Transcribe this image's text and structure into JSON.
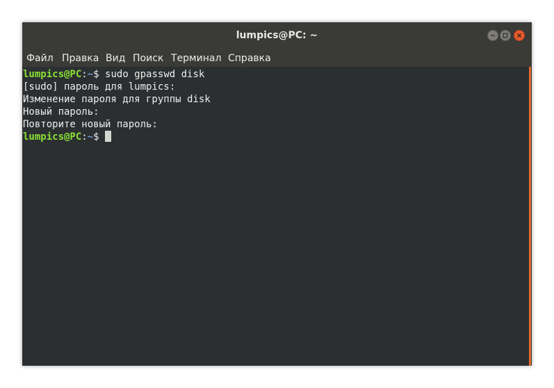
{
  "window": {
    "title": "lumpics@PC: ~"
  },
  "menu": {
    "items": [
      "Файл",
      "Правка",
      "Вид",
      "Поиск",
      "Терминал",
      "Справка"
    ]
  },
  "terminal": {
    "prompt_user": "lumpics@PC",
    "prompt_colon": ":",
    "prompt_path": "~",
    "prompt_symbol": "$ ",
    "command": "sudo gpasswd disk",
    "output": [
      "[sudo] пароль для lumpics:",
      "Изменение пароля для группы disk",
      "Новый пароль:",
      "Повторите новый пароль:"
    ]
  },
  "colors": {
    "prompt_user": "#8ae234",
    "prompt_path": "#729fcf",
    "background": "#2b2f31",
    "close_button": "#e85a2c",
    "scrollbar": "#e06b2d"
  },
  "icons": {
    "minimize": "minimize-icon",
    "maximize": "maximize-icon",
    "close": "close-icon"
  }
}
